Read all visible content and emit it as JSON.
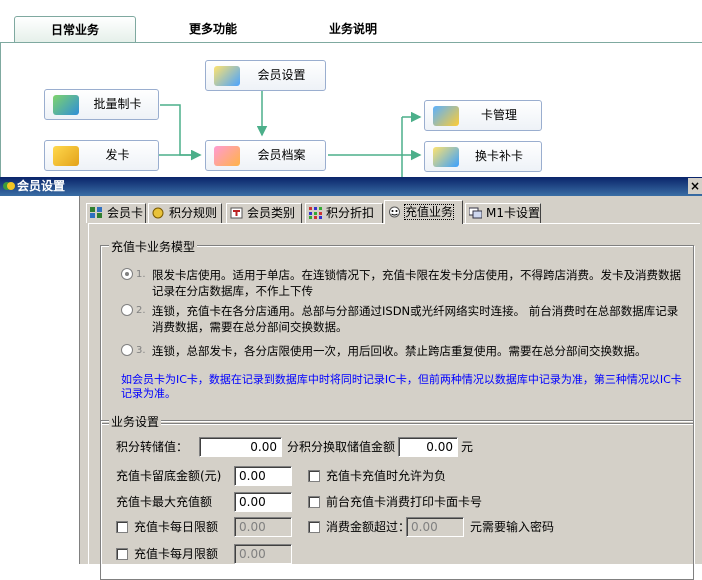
{
  "top_tabs": [
    "日常业务",
    "更多功能",
    "业务说明"
  ],
  "flow": {
    "member_settings": "会员设置",
    "batch_card": "批量制卡",
    "issue_card": "发卡",
    "member_records": "会员档案",
    "card_management": "卡管理",
    "card_replace": "换卡补卡"
  },
  "window": {
    "title": "会员设置",
    "close": "×"
  },
  "tabs": [
    "会员卡",
    "积分规则",
    "会员类别",
    "积分折扣",
    "充值业务",
    "M1卡设置"
  ],
  "active_tab": "充值业务",
  "model_group": {
    "title": "充值卡业务模型",
    "options": [
      {
        "num": "1.",
        "text": "限发卡店使用。适用于单店。在连锁情况下，充值卡限在发卡分店使用，不得跨店消费。发卡及消费数据记录在分店数据库，不作上下传"
      },
      {
        "num": "2.",
        "text": "连锁，充值卡在各分店通用。总部与分部通过ISDN或光纤网络实时连接。 前台消费时在总部数据库记录消费数据，需要在总分部间交换数据。"
      },
      {
        "num": "3.",
        "text": "连锁，总部发卡，各分店限使用一次，用后回收。禁止跨店重复使用。需要在总分部间交换数据。"
      }
    ],
    "selected": 0,
    "note": "如会员卡为IC卡，数据在记录到数据库中时将同时记录IC卡，但前两种情况以数据库中记录为准，第三种情况以IC卡记录为准。"
  },
  "biz_group": {
    "title": "业务设置",
    "points_to_value_label": "积分转储值：",
    "points_to_value": "0.00",
    "points_per_label": "分积分换取储值金额",
    "points_per_value": "0.00",
    "yuan": "元",
    "min_balance_label": "充值卡留底金额(元)",
    "min_balance": "0.00",
    "max_recharge_label": "充值卡最大充值额",
    "max_recharge": "0.00",
    "daily_limit_label": "充值卡每日限额",
    "daily_limit": "0.00",
    "monthly_limit_label": "充值卡每月限额",
    "monthly_limit": "0.00",
    "allow_negative_label": "充值卡充值时允许为负",
    "print_card_label": "前台充值卡消费打印卡面卡号",
    "amount_exceed_label": "消费金额超过：",
    "amount_exceed": "0.00",
    "need_password_label": "元需要输入密码"
  },
  "colors": {
    "titlebar_start": "#0a246a",
    "titlebar_end": "#3a6ea5",
    "dialog_bg": "#d4d0c8",
    "note_blue": "#0000ff",
    "flow_arrow": "#4caf8a"
  }
}
